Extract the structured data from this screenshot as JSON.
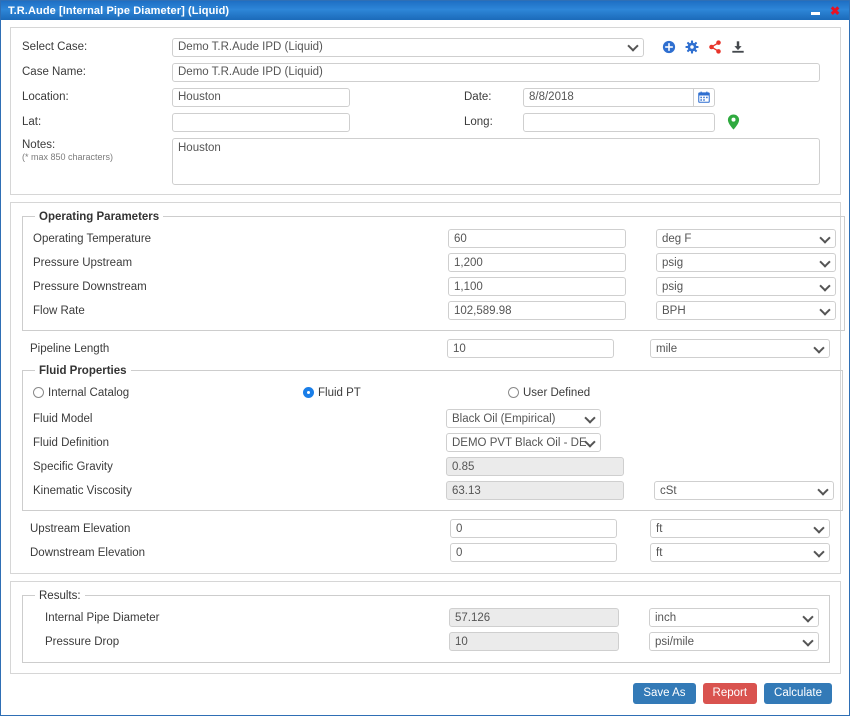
{
  "window": {
    "title": "T.R.Aude [Internal Pipe Diameter] (Liquid)",
    "minimize_label": "–",
    "close_label": "✕"
  },
  "case_section": {
    "select_case_label": "Select Case:",
    "select_case_value": "Demo T.R.Aude IPD (Liquid)",
    "case_name_label": "Case Name:",
    "case_name_value": "Demo T.R.Aude IPD (Liquid)",
    "location_label": "Location:",
    "location_value": "Houston",
    "date_label": "Date:",
    "date_value": "8/8/2018",
    "lat_label": "Lat:",
    "lat_value": "",
    "long_label": "Long:",
    "long_value": "",
    "notes_label": "Notes:",
    "notes_sub": "(* max 850 characters)",
    "notes_value": "Houston",
    "icons": {
      "add": "add-circle-icon",
      "settings": "gear-icon",
      "share": "share-icon",
      "download": "download-icon",
      "calendar": "calendar-icon",
      "map_pin": "map-pin-icon"
    }
  },
  "operating": {
    "legend": "Operating Parameters",
    "rows": [
      {
        "label": "Operating Temperature",
        "value": "60",
        "unit": "deg F"
      },
      {
        "label": "Pressure Upstream",
        "value": "1,200",
        "unit": "psig"
      },
      {
        "label": "Pressure Downstream",
        "value": "1,100",
        "unit": "psig"
      },
      {
        "label": "Flow Rate",
        "value": "102,589.98",
        "unit": "BPH"
      }
    ]
  },
  "pipeline_length": {
    "label": "Pipeline Length",
    "value": "10",
    "unit": "mile"
  },
  "fluid": {
    "legend": "Fluid Properties",
    "options": [
      {
        "label": "Internal Catalog",
        "selected": false
      },
      {
        "label": "Fluid PT",
        "selected": true
      },
      {
        "label": "User Defined",
        "selected": false
      }
    ],
    "fluid_model_label": "Fluid Model",
    "fluid_model_value": "Black Oil (Empirical)",
    "fluid_definition_label": "Fluid Definition",
    "fluid_definition_value": "DEMO PVT Black Oil - DEMO",
    "specific_gravity_label": "Specific Gravity",
    "specific_gravity_value": "0.85",
    "kinematic_viscosity_label": "Kinematic Viscosity",
    "kinematic_viscosity_value": "63.13",
    "kinematic_viscosity_unit": "cSt"
  },
  "elevation": {
    "upstream_label": "Upstream Elevation",
    "upstream_value": "0",
    "upstream_unit": "ft",
    "downstream_label": "Downstream Elevation",
    "downstream_value": "0",
    "downstream_unit": "ft"
  },
  "results": {
    "legend": "Results:",
    "rows": [
      {
        "label": "Internal Pipe Diameter",
        "value": "57.126",
        "unit": "inch"
      },
      {
        "label": "Pressure Drop",
        "value": "10",
        "unit": "psi/mile"
      }
    ]
  },
  "buttons": {
    "save_as": "Save As",
    "report": "Report",
    "calculate": "Calculate"
  },
  "colors": {
    "titlebar_blue": "#2e86d8",
    "primary_button": "#337ab7",
    "danger_button": "#d9534f",
    "accent_blue": "#1a7ee8",
    "share_red": "#e8342a",
    "pin_green": "#2faa3f",
    "close_red": "#e81123"
  }
}
